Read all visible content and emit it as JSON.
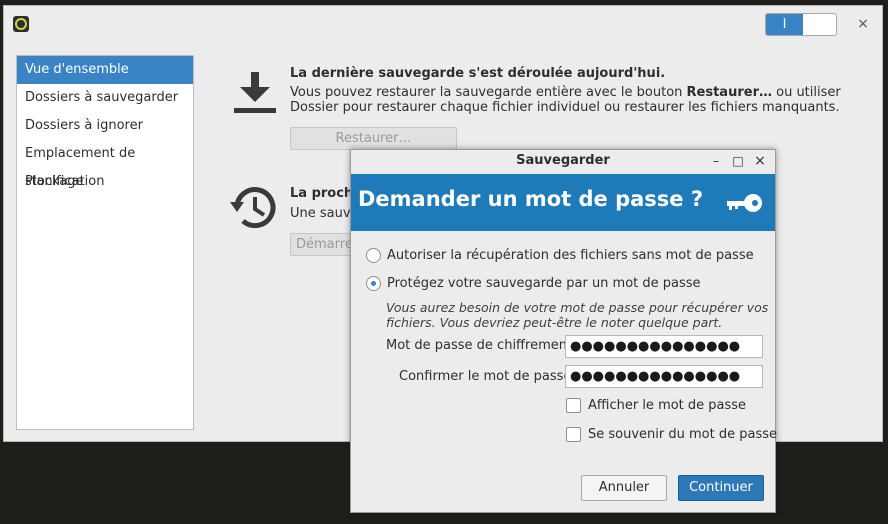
{
  "main_window": {
    "toggle_label": "I",
    "close_glyph": "×",
    "sidebar": {
      "items": [
        {
          "label": "Vue d'ensemble",
          "active": true
        },
        {
          "label": "Dossiers à sauvegarder"
        },
        {
          "label": "Dossiers à ignorer"
        },
        {
          "label": "Emplacement de stockage"
        },
        {
          "label": "Planification"
        }
      ]
    },
    "restore": {
      "title": "La dernière sauvegarde s'est déroulée aujourd'hui.",
      "desc_part1": "Vous pouvez restaurer la sauvegarde entière avec le bouton ",
      "desc_bold": "Restaurer…",
      "desc_part2": " ou utiliser",
      "desc_line2": "Dossier pour restaurer chaque fichier individuel ou restaurer les fichiers manquants.",
      "button_label": "Restaurer…",
      "icon": "download-icon"
    },
    "next_backup": {
      "title": "La procha",
      "desc": "Une sauve",
      "button_label": "Démarrer",
      "icon": "history-clock-icon"
    }
  },
  "dialog": {
    "window_title": "Sauvegarder",
    "controls": {
      "minimize": "–",
      "maximize": "□",
      "close": "×"
    },
    "banner_title": "Demander un mot de passe ?",
    "banner_icon": "key-icon",
    "options": [
      {
        "label": "Autoriser la récupération des fichiers sans mot de passe",
        "checked": false
      },
      {
        "label": "Protégez votre sauvegarde par un mot de passe",
        "checked": true
      }
    ],
    "hint_line1": "Vous aurez besoin de votre mot de passe pour récupérer vos",
    "hint_line2": "fichiers. Vous devriez peut-être le noter quelque part.",
    "password_label": "Mot de passe de chiffrement",
    "password_value": "●●●●●●●●●●●●●●●",
    "confirm_label": "Confirmer le mot de passe",
    "confirm_value": "●●●●●●●●●●●●●●●",
    "show_password_label": "Afficher le mot de passe",
    "remember_password_label": "Se souvenir du mot de passe",
    "cancel_label": "Annuler",
    "continue_label": "Continuer"
  },
  "colors": {
    "accent": "#3a84c6",
    "banner": "#1e7ab8",
    "window_bg": "#ececec",
    "desktop_bg": "#1e1f1a"
  }
}
